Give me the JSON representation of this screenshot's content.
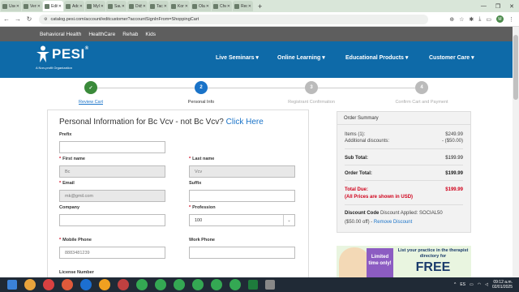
{
  "browser": {
    "tabs": [
      {
        "title": "Use c",
        "active": false
      },
      {
        "title": "Verifi",
        "active": false
      },
      {
        "title": "Edit A",
        "active": true
      },
      {
        "title": "Add I",
        "active": false
      },
      {
        "title": "MyCa",
        "active": false
      },
      {
        "title": "Sausa",
        "active": false
      },
      {
        "title": "Didy",
        "active": false
      },
      {
        "title": "Tackle",
        "active": false
      },
      {
        "title": "Korea",
        "active": false
      },
      {
        "title": "Ola S",
        "active": false
      },
      {
        "title": "Chec",
        "active": false
      },
      {
        "title": "Recib",
        "active": false
      }
    ],
    "url": "catalog.pesi.com/account/editcustomer?accountSignInFrom=ShoppingCart",
    "profile_initial": "M"
  },
  "site": {
    "top_links": [
      "Behavioral Health",
      "HealthCare",
      "Rehab",
      "Kids"
    ],
    "logo_text": "PESI",
    "logo_reg": "®",
    "logo_tagline": "A Non-profit Organization",
    "menu": [
      "Live Seminars ▾",
      "Online Learning ▾",
      "Educational Products ▾",
      "Customer Care ▾"
    ],
    "brand_color": "#0e6aa8"
  },
  "stepper": {
    "steps": [
      {
        "num": "✓",
        "label": "Review Cart",
        "state": "done"
      },
      {
        "num": "2",
        "label": "Personal Info",
        "state": "current"
      },
      {
        "num": "3",
        "label": "Registrant Confirmation",
        "state": "todo"
      },
      {
        "num": "4",
        "label": "Confirm Cart and Payment",
        "state": "todo"
      }
    ]
  },
  "form": {
    "title": "Personal Information for Bc Vcv - not Bc Vcv?",
    "title_link": "Click Here",
    "prefix_label": "Prefix",
    "first_name_label": "First name",
    "first_name_value": "Bc",
    "last_name_label": "Last name",
    "last_name_value": "Vcv",
    "email_label": "Email",
    "email_value": "mk@gmil.com",
    "suffix_label": "Suffix",
    "company_label": "Company",
    "profession_label": "Profession",
    "profession_value": "100",
    "mobile_label": "Mobile Phone",
    "mobile_value": "8883481239",
    "work_label": "Work Phone",
    "license_label": "License Number"
  },
  "summary": {
    "heading": "Order Summary",
    "items_label": "Items (1):",
    "items_value": "$249.99",
    "discounts_label": "Additional discounts:",
    "discounts_value": "- ($50.00)",
    "subtotal_label": "Sub Total:",
    "subtotal_value": "$199.99",
    "order_total_label": "Order Total:",
    "order_total_value": "$199.99",
    "total_due_label": "Total Due:",
    "total_due_value": "$199.99",
    "currency_note": "(All Prices are shown in USD)",
    "discount_code_label": "Discount Code",
    "discount_applied": "Discount Applied: SOCIAL50",
    "discount_off": "($50.00 off) -",
    "remove_discount": "Remove Discount"
  },
  "ad": {
    "badge": "Limited time only!",
    "text": "List your practice in the therapist directory for",
    "free": "FREE"
  },
  "taskbar": {
    "lang": "ES",
    "time": "09:12 a.m.",
    "date": "02/01/2025"
  }
}
